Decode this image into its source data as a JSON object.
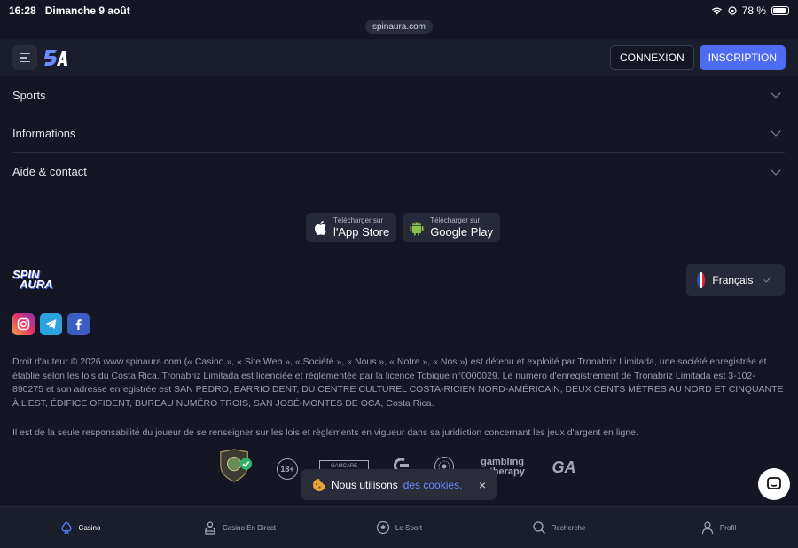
{
  "status_bar": {
    "time": "16:28",
    "date": "Dimanche 9 août",
    "battery": "78 %"
  },
  "address_bar": {
    "url": "spinaura.com"
  },
  "header": {
    "logo_icon": "spinaura-logo-icon",
    "login_label": "CONNEXION",
    "register_label": "INSCRIPTION"
  },
  "accordion": {
    "items": [
      {
        "label": "Sports"
      },
      {
        "label": "Informations"
      },
      {
        "label": "Aide & contact"
      }
    ]
  },
  "stores": {
    "app_store": {
      "small": "Télécharger sur",
      "big": "l'App Store"
    },
    "google_play": {
      "small": "Télécharger sur",
      "big": "Google Play"
    }
  },
  "brand": {
    "logo_line1": "SPIN",
    "logo_line2": "AURA"
  },
  "language": {
    "selected": "Français"
  },
  "socials": [
    "instagram-icon",
    "telegram-icon",
    "facebook-icon"
  ],
  "legal": {
    "copyright": "Droit d'auteur © 2026 www.spinaura.com (« Casino », « Site Web », « Société », « Nous », « Notre », « Nos ») est détenu et exploité par Tronabriz Limitada, une société enregistrée et établie selon les lois du Costa Rica. Tronabriz Limitada est licenciée et réglementée par la licence Tobique n°0000029. Le numéro d'enregistrement de Tronabriz Limitada est 3-102-890275 et son adresse enregistrée est SAN PEDRO, BARRIO DENT, DU CENTRE CULTUREL COSTA-RICIEN NORD-AMÉRICAIN, DEUX CENTS MÈTRES AU NORD ET CINQUANTE À L'EST, ÉDIFICE OFIDENT, BUREAU NUMÉRO TROIS, SAN JOSÉ-MONTES DE OCA, Costa Rica.",
    "responsibility": "Il est de la seule responsabilité du joueur de se renseigner sur les lois et règlements en vigueur dans sa juridiction concernant les jeux d'argent en ligne."
  },
  "badges": {
    "age": "18+",
    "gamcare": "GAMCARE",
    "gambling_therapy_1": "gambling",
    "gambling_therapy_2": "therapy",
    "ga": "GA"
  },
  "cookie": {
    "text": "Nous utilisons",
    "link": "des cookies.",
    "close": "×"
  },
  "bottom_nav": [
    {
      "label": "Casino",
      "icon": "casino-icon",
      "active": true
    },
    {
      "label": "Casino En Direct",
      "icon": "live-casino-icon",
      "active": false
    },
    {
      "label": "Le Sport",
      "icon": "sport-icon",
      "active": false
    },
    {
      "label": "Recherche",
      "icon": "search-icon",
      "active": false
    },
    {
      "label": "Profil",
      "icon": "profile-icon",
      "active": false
    }
  ],
  "colors": {
    "background": "#141623",
    "header": "#1a1d2b",
    "accent": "#4e6cf2",
    "link": "#6b8cff"
  }
}
